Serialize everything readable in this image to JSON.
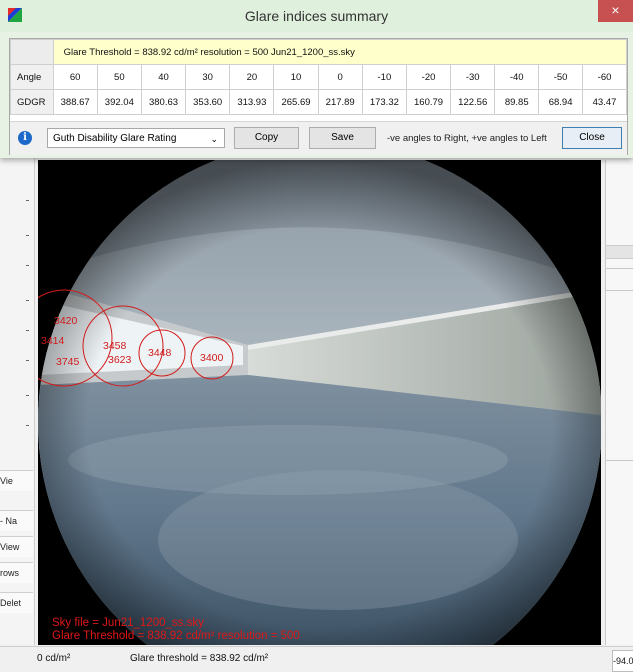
{
  "dialog": {
    "title": "Glare indices summary",
    "close_glyph": "×",
    "info_line": "Glare Threshold = 838.92 cd/m²   resolution = 500   Jun21_1200_ss.sky",
    "rows": [
      {
        "header": "Angle",
        "values": [
          "60",
          "50",
          "40",
          "30",
          "20",
          "10",
          "0",
          "-10",
          "-20",
          "-30",
          "-40",
          "-50",
          "-60"
        ]
      },
      {
        "header": "GDGR",
        "values": [
          "388.67",
          "392.04",
          "380.63",
          "353.60",
          "313.93",
          "265.69",
          "217.89",
          "173.32",
          "160.79",
          "122.56",
          "89.85",
          "68.94",
          "43.47"
        ]
      }
    ],
    "metric_select": "Guth Disability Glare Rating",
    "copy_label": "Copy",
    "save_label": "Save",
    "hint": "-ve angles to Right, +ve angles to Left",
    "close_label": "Close",
    "info_icon": "i"
  },
  "viewport": {
    "glare_labels": [
      "3420",
      "3414",
      "3745",
      "3458",
      "3623",
      "3448",
      "3400"
    ],
    "sky_file_line": "Sky file = Jun21_1200_ss.sky",
    "threshold_line": "Glare Threshold =  838.92 cd/m²  resolution = 500"
  },
  "sidebar": {
    "labels": [
      "Vie",
      "- Na",
      "View",
      "rows",
      "Delet"
    ]
  },
  "status_bar": {
    "luminance": "0 cd/m²",
    "threshold": "Glare threshold = 838.92 cd/m²",
    "right_value": "-94.0"
  },
  "colors": {
    "dialog_bg": "#e7f2e4",
    "info_row": "#ffffcc",
    "glare_marker": "#e01818",
    "close_x": "#c75050"
  }
}
